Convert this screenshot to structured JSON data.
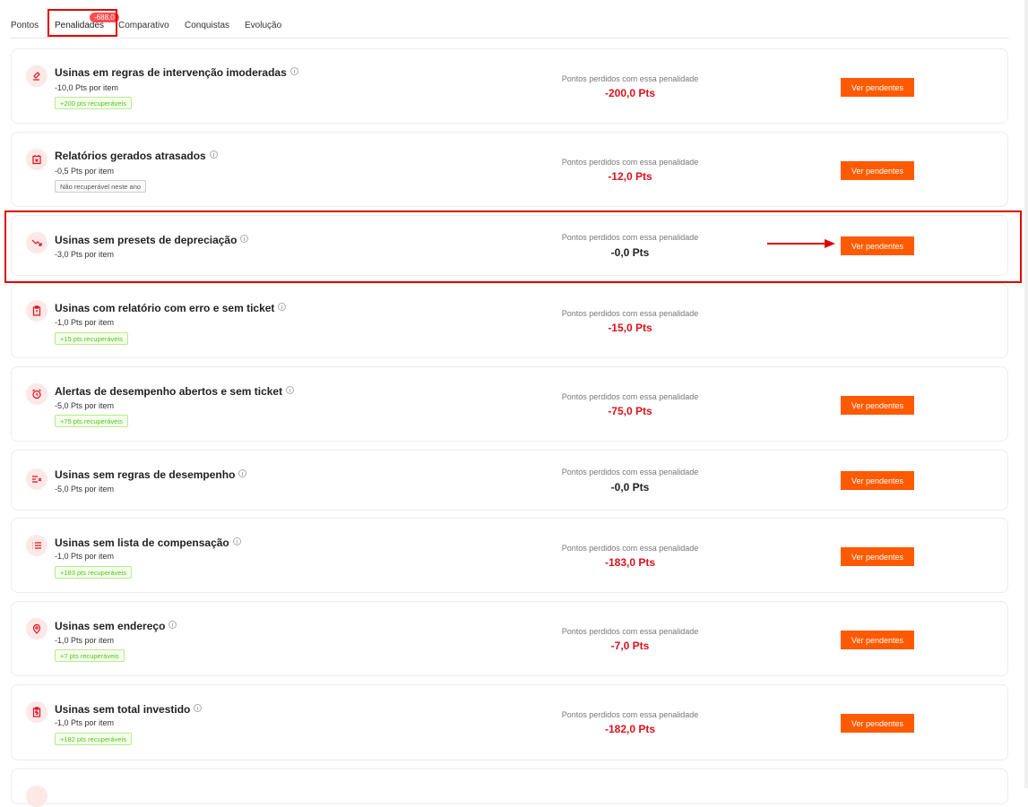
{
  "tabs": [
    {
      "label": "Pontos"
    },
    {
      "label": "Penalidades",
      "badge": "-688,0",
      "active": true
    },
    {
      "label": "Comparativo"
    },
    {
      "label": "Conquistas"
    },
    {
      "label": "Evolução"
    }
  ],
  "lost_label": "Pontos perdidos com essa penalidade",
  "button_label": "Ver pendentes",
  "colors": {
    "accent": "#ff5a00",
    "negative": "#d9121d",
    "recoverable": "#52c41a",
    "highlight": "#e00000"
  },
  "penalties": [
    {
      "title": "Usinas em regras de intervenção imoderadas",
      "per_item": "-10,0 Pts por item",
      "tag": "+200 pts recuperáveis",
      "tag_type": "ok",
      "lost": "-200,0 Pts",
      "icon": "gavel-icon",
      "has_button": true
    },
    {
      "title": "Relatórios gerados atrasados",
      "per_item": "-0,5 Pts por item",
      "tag": "Não recuperável neste ano",
      "tag_type": "no",
      "lost": "-12,0 Pts",
      "icon": "calendar-x-icon",
      "has_button": true
    },
    {
      "title": "Usinas sem presets de depreciação",
      "per_item": "-3,0 Pts por item",
      "tag": "",
      "tag_type": "",
      "lost": "-0,0 Pts",
      "icon": "trending-down-icon",
      "has_button": true,
      "highlighted": true
    },
    {
      "title": "Usinas com relatório com erro e sem ticket",
      "per_item": "-1,0 Pts por item",
      "tag": "+15 pts recuperáveis",
      "tag_type": "ok",
      "lost": "-15,0 Pts",
      "icon": "clipboard-icon",
      "has_button": false
    },
    {
      "title": "Alertas de desempenho abertos e sem ticket",
      "per_item": "-5,0 Pts por item",
      "tag": "+75 pts recuperáveis",
      "tag_type": "ok",
      "lost": "-75,0 Pts",
      "icon": "alarm-icon",
      "has_button": true
    },
    {
      "title": "Usinas sem regras de desempenho",
      "per_item": "-5,0 Pts por item",
      "tag": "",
      "tag_type": "",
      "lost": "-0,0 Pts",
      "icon": "list-x-icon",
      "has_button": true
    },
    {
      "title": "Usinas sem lista de compensação",
      "per_item": "-1,0 Pts por item",
      "tag": "+183 pts recuperáveis",
      "tag_type": "ok",
      "lost": "-183,0 Pts",
      "icon": "list-icon",
      "has_button": true
    },
    {
      "title": "Usinas sem endereço",
      "per_item": "-1,0 Pts por item",
      "tag": "+7 pts recuperáveis",
      "tag_type": "ok",
      "lost": "-7,0 Pts",
      "icon": "map-pin-icon",
      "has_button": true
    },
    {
      "title": "Usinas sem total investido",
      "per_item": "-1,0 Pts por item",
      "tag": "+182 pts recuperáveis",
      "tag_type": "ok",
      "lost": "-182,0 Pts",
      "icon": "clipboard-dollar-icon",
      "has_button": true
    }
  ]
}
